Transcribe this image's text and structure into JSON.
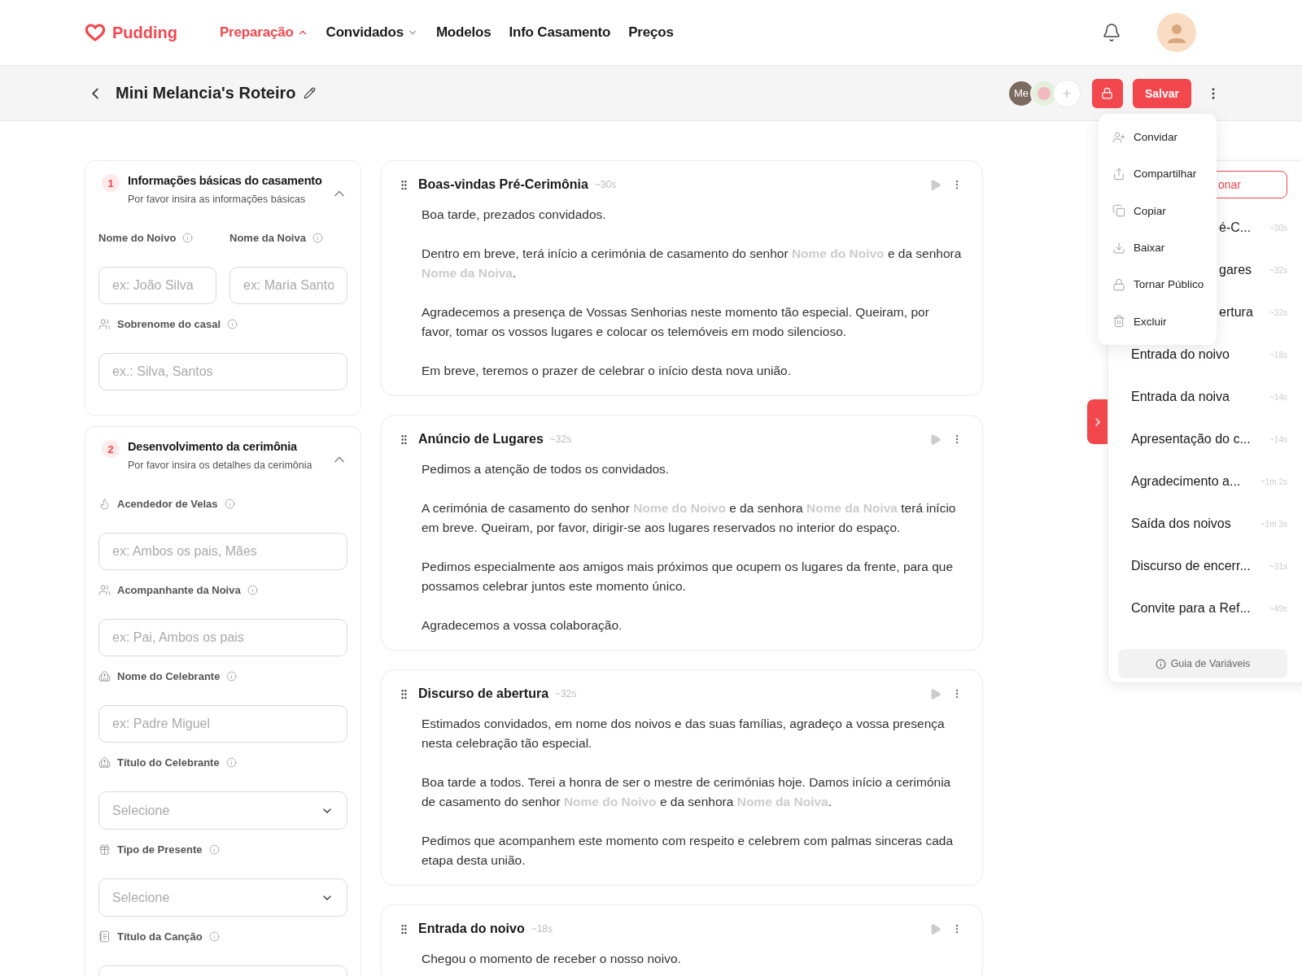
{
  "header": {
    "logo": "Pudding",
    "nav": [
      {
        "label": "Preparação",
        "selected": true,
        "expanded": true
      },
      {
        "label": "Convidados",
        "selected": false,
        "expanded": false
      },
      {
        "label": "Modelos",
        "selected": false
      },
      {
        "label": "Info Casamento",
        "selected": false
      },
      {
        "label": "Preços",
        "selected": false
      }
    ]
  },
  "toolbar": {
    "title": "Mini Melancia's Roteiro",
    "collaborators": [
      {
        "kind": "initials",
        "label": "Me"
      },
      {
        "kind": "avatar"
      }
    ],
    "save": "Salvar"
  },
  "menu": {
    "items": [
      {
        "label": "Convidar"
      },
      {
        "label": "Compartilhar"
      },
      {
        "label": "Copiar"
      },
      {
        "label": "Baixar"
      },
      {
        "label": "Tornar Público"
      },
      {
        "label": "Excluir"
      }
    ]
  },
  "sections": [
    {
      "number": "1",
      "title": "Informações básicas do casamento",
      "subtitle": "Por favor insira as informações básicas",
      "expanded": true,
      "fields": [
        {
          "kind": "text",
          "half": true,
          "label": "Nome do Noivo",
          "placeholder": "ex: João Silva"
        },
        {
          "kind": "text",
          "half": true,
          "label": "Nome da Noiva",
          "placeholder": "ex: Maria Santo"
        },
        {
          "kind": "text",
          "half": false,
          "label": "Sobrenome do casal",
          "placeholder": "ex.: Silva, Santos"
        }
      ]
    },
    {
      "number": "2",
      "title": "Desenvolvimento da cerimônia",
      "subtitle": "Por favor insira os detalhes da cerimônia",
      "expanded": true,
      "fields": [
        {
          "kind": "text",
          "half": false,
          "label": "Acendedor de Velas",
          "placeholder": "ex: Ambos os pais, Mães"
        },
        {
          "kind": "text",
          "half": false,
          "label": "Acompanhante da Noiva",
          "placeholder": "ex: Pai, Ambos os pais"
        },
        {
          "kind": "text",
          "half": false,
          "label": "Nome do Celebrante",
          "placeholder": "ex: Padre Miguel"
        },
        {
          "kind": "select",
          "half": false,
          "label": "Título do Celebrante",
          "placeholder": "Selecione"
        },
        {
          "kind": "select",
          "half": false,
          "label": "Tipo de Presente",
          "placeholder": "Selecione"
        },
        {
          "kind": "text",
          "half": false,
          "label": "Título da Canção"
        }
      ]
    }
  ],
  "scripts": [
    {
      "title": "Boas-vindas Pré-Cerimônia",
      "duration": "~30s",
      "paragraphs": [
        "Boa tarde, prezados convidados.",
        "Dentro em breve, terá início a cerimónia de casamento do senhor **Nome do Noivo** e da senhora **Nome da Noiva**.",
        "Agradecemos a presença de Vossas Senhorias neste momento tão especial. Queiram, por favor, tomar os vossos lugares e colocar os telemóveis em modo silencioso.",
        "Em breve, teremos o prazer de celebrar o início desta nova união."
      ]
    },
    {
      "title": "Anúncio de Lugares",
      "duration": "~32s",
      "paragraphs": [
        "Pedimos a atenção de todos os convidados.",
        "A cerimónia de casamento do senhor **Nome do Noivo** e da senhora **Nome da Noiva** terá início em breve. Queiram, por favor, dirigir-se aos lugares reservados no interior do espaço.",
        "Pedimos especialmente aos amigos mais próximos que ocupem os lugares da frente, para que possamos celebrar juntos este momento único.",
        "Agradecemos a vossa colaboração."
      ]
    },
    {
      "title": "Discurso de abertura",
      "duration": "~32s",
      "paragraphs": [
        "Estimados convidados, em nome dos noivos e das suas famílias, agradeço a vossa presença nesta celebração tão especial.",
        "Boa tarde a todos. Terei a honra de ser o mestre de cerimónias hoje. Damos início a cerimónia de casamento do senhor **Nome do Noivo** e da senhora **Nome da Noiva**.",
        "Pedimos que acompanhem este momento com respeito e celebrem com palmas sinceras cada etapa desta união."
      ]
    },
    {
      "title": "Entrada do noivo",
      "duration": "~18s",
      "paragraphs": [
        "Chegou o momento de receber o nosso noivo."
      ]
    }
  ],
  "outline": {
    "select": "onar",
    "items": [
      {
        "name": "é-C...",
        "duration": "~30s",
        "partial": true
      },
      {
        "name": "gares",
        "duration": "~32s",
        "partial": true
      },
      {
        "name": "ertura",
        "duration": "~32s",
        "partial": true
      },
      {
        "name": "Entrada do noivo",
        "duration": "~18s",
        "partial": false
      },
      {
        "name": "Entrada da noiva",
        "duration": "~14s",
        "partial": false
      },
      {
        "name": "Apresentação do c...",
        "duration": "~14s",
        "partial": false
      },
      {
        "name": "Agradecimento a...",
        "duration": "~1m 2s",
        "partial": false
      },
      {
        "name": "Saída dos noivos",
        "duration": "~1m 3s",
        "partial": false
      },
      {
        "name": "Discurso de encerr...",
        "duration": "~31s",
        "partial": false
      },
      {
        "name": "Convite para a Ref...",
        "duration": "~49s",
        "partial": false
      }
    ],
    "guide": "Guia de Variáveis"
  }
}
